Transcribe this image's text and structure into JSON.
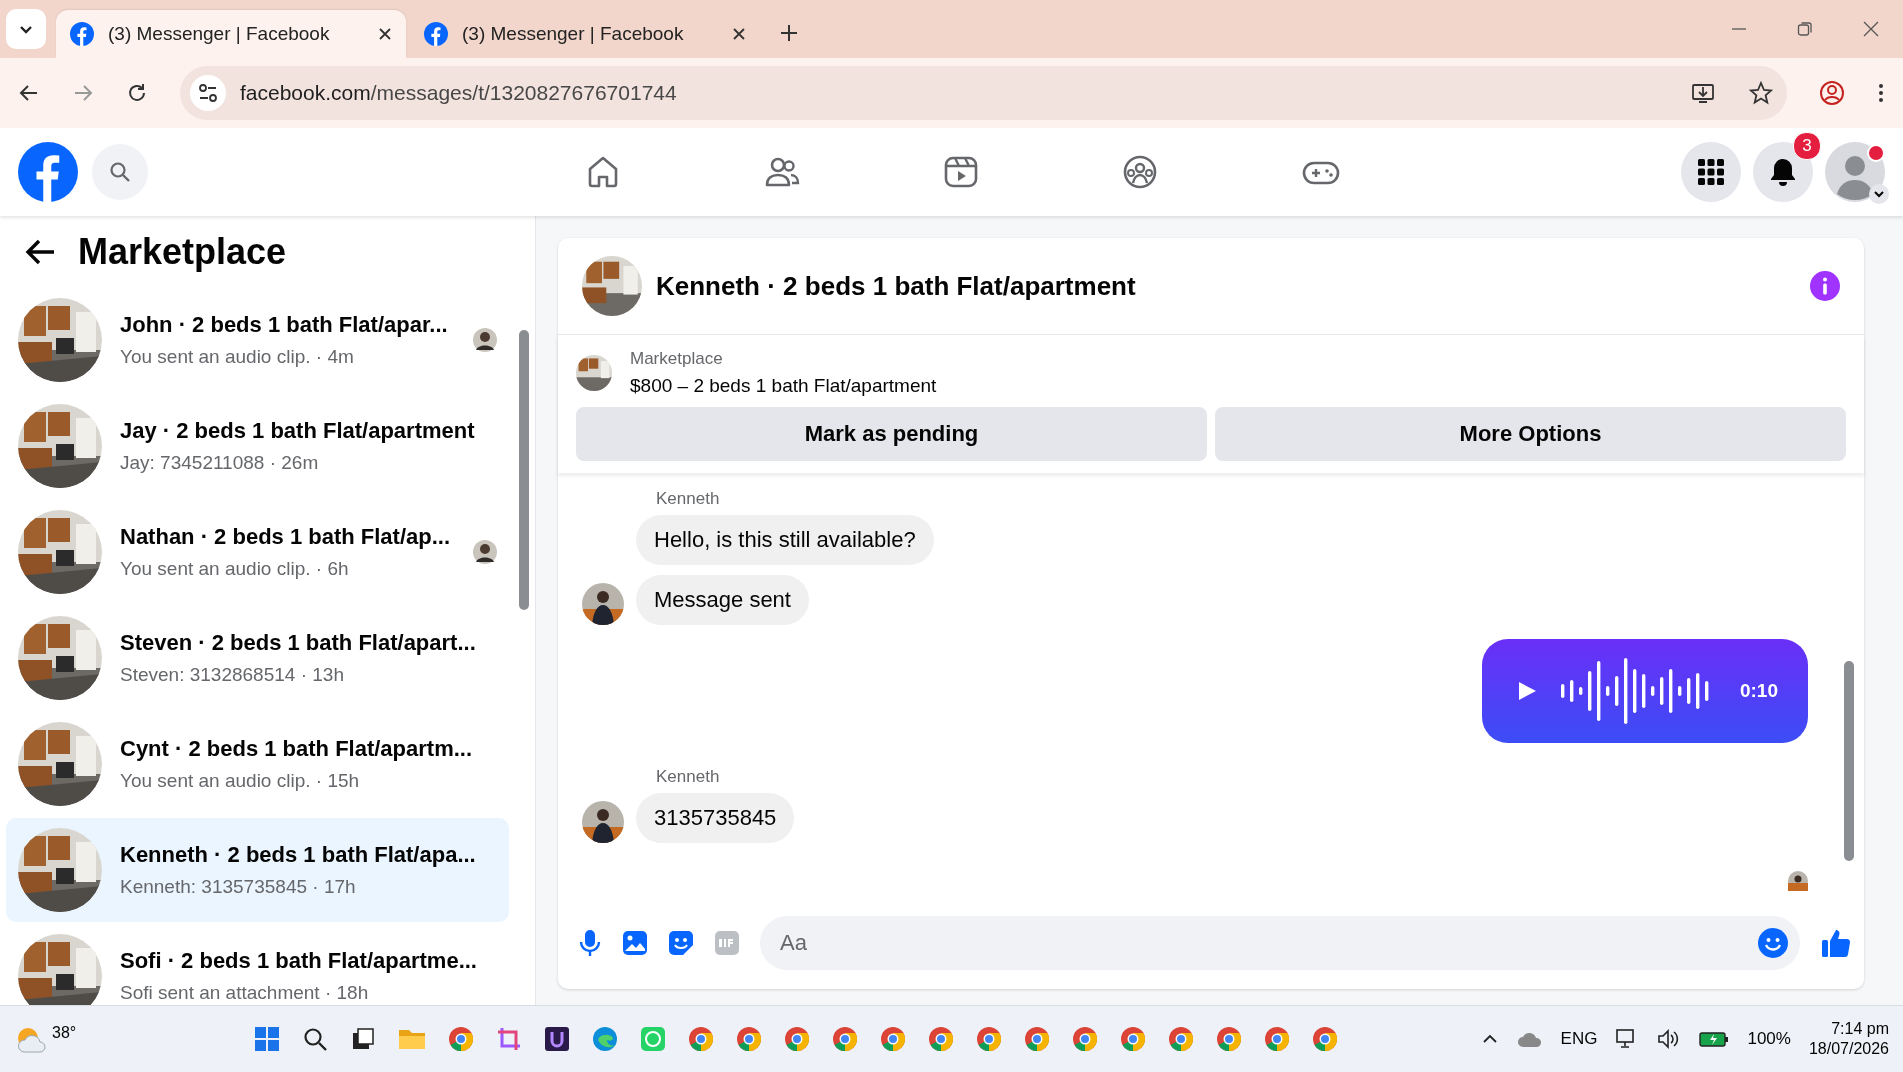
{
  "browser": {
    "tabs": [
      {
        "title": "(3) Messenger | Facebook",
        "selected": true
      },
      {
        "title": "(3) Messenger | Facebook",
        "selected": false
      }
    ],
    "address": {
      "host": "facebook.com",
      "path": "/messages/t/1320827676701744"
    }
  },
  "header": {
    "notification_count": "3"
  },
  "sidebar": {
    "title": "Marketplace",
    "conversations": [
      {
        "name": "John · 2 beds 1 bath Flat/apar...",
        "preview": "You sent an audio clip. · 4m",
        "seen": true,
        "selected": false
      },
      {
        "name": "Jay · 2 beds 1 bath Flat/apartment",
        "preview": "Jay: 7345211088 · 26m",
        "seen": false,
        "selected": false
      },
      {
        "name": "Nathan · 2 beds 1 bath Flat/ap...",
        "preview": "You sent an audio clip. · 6h",
        "seen": true,
        "selected": false
      },
      {
        "name": "Steven · 2 beds 1 bath Flat/apart...",
        "preview": "Steven: 3132868514 · 13h",
        "seen": false,
        "selected": false
      },
      {
        "name": "Cynt · 2 beds 1 bath Flat/apartm...",
        "preview": "You sent an audio clip. · 15h",
        "seen": false,
        "selected": false
      },
      {
        "name": "Kenneth · 2 beds 1 bath Flat/apa...",
        "preview": "Kenneth: 3135735845 · 17h",
        "seen": false,
        "selected": true
      },
      {
        "name": "Sofi · 2 beds 1 bath Flat/apartme...",
        "preview": "Sofi sent an attachment · 18h",
        "seen": false,
        "selected": false
      }
    ]
  },
  "chat": {
    "title": "Kenneth · 2 beds 1 bath Flat/apartment",
    "listing": {
      "label": "Marketplace",
      "price_title": "$800 – 2 beds 1 bath Flat/apartment"
    },
    "buttons": [
      "Mark as pending",
      "More Options"
    ],
    "messages": [
      {
        "kind": "text",
        "sender": "Kenneth",
        "text": "Hello, is this still available?",
        "avatar": false
      },
      {
        "kind": "text",
        "text": "Message sent",
        "avatar": true
      },
      {
        "kind": "audio",
        "duration": "0:10"
      },
      {
        "kind": "text",
        "sender": "Kenneth",
        "text": "3135735845",
        "avatar": true
      }
    ],
    "composer": {
      "placeholder": "Aa"
    }
  },
  "taskbar": {
    "weather": "38°",
    "language": "ENG",
    "battery": "100%",
    "time": "7:14 pm",
    "date": "18/07/2026"
  }
}
